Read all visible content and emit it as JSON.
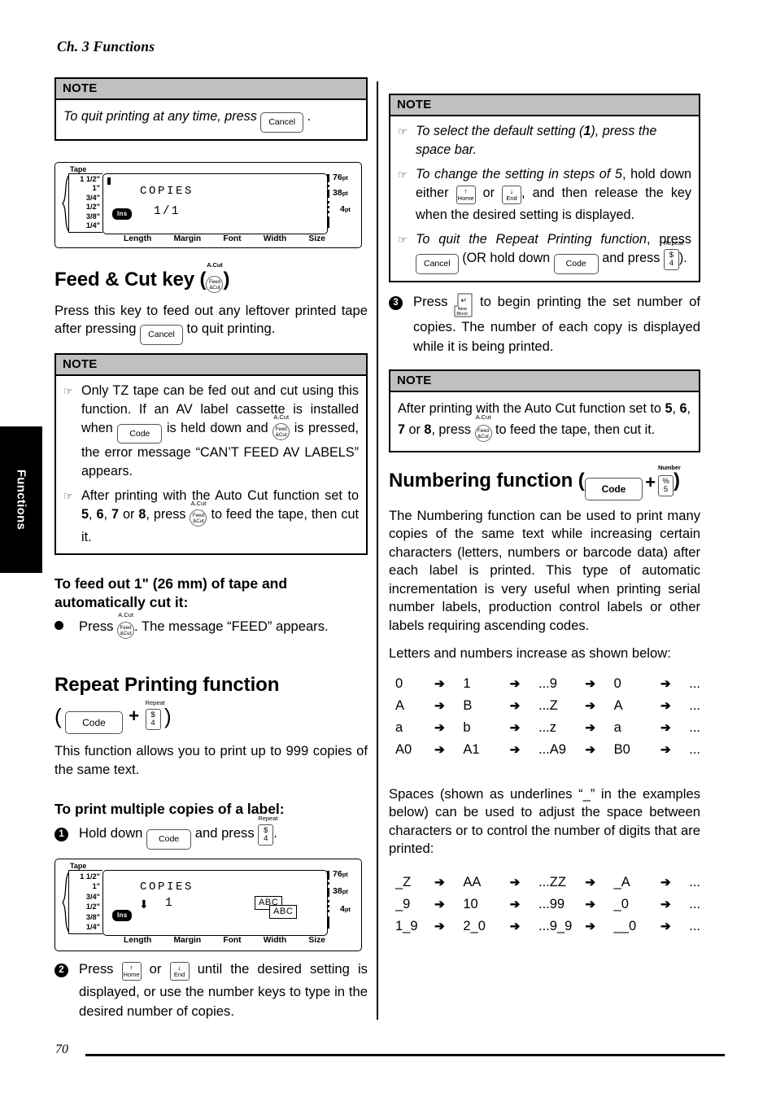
{
  "page": {
    "running_head": "Ch. 3 Functions",
    "page_number": "70",
    "thumb_tab": "Functions"
  },
  "keys": {
    "cancel": "Cancel",
    "code": "Code",
    "feedcut_top": "A.Cut",
    "feedcut_line1": "Feed",
    "feedcut_line2": "&Cut",
    "repeat_top": "Repeat",
    "repeat_sym": "$",
    "repeat_num": "4",
    "number_top": "Number",
    "number_sym": "%",
    "number_num": "5",
    "home_arrow": "↑",
    "home_label": "Home",
    "end_arrow": "↓",
    "end_label": "End",
    "newblock_arrow": "↵",
    "newblock_line1": "New",
    "newblock_line2": "Block",
    "plus": "+"
  },
  "left": {
    "note1": {
      "title": "NOTE",
      "text_before": "To quit printing at any time, press",
      "text_after": "."
    },
    "lcd1": {
      "tape_label": "Tape",
      "tape_sizes": [
        "1 1/2\"",
        "1\"",
        "3/4\"",
        "1/2\"",
        "3/8\"",
        "1/4\""
      ],
      "word": "COPIES",
      "value": "1/1",
      "ins": "Ins",
      "pt_labels": [
        "76",
        "38",
        "4"
      ],
      "pt_unit": "pt",
      "bottom_labels": [
        "Length",
        "Margin",
        "Font",
        "Width",
        "Size"
      ]
    },
    "feedcut_heading_before": "Feed & Cut key (",
    "feedcut_heading_after": ")",
    "feedcut_para_1": "Press this key to feed out any leftover printed tape after pressing",
    "feedcut_para_2": "to quit printing.",
    "note2": {
      "title": "NOTE",
      "item1_a": "Only TZ tape can be fed out and cut using this function. If an AV label cassette is installed when",
      "item1_b": "is held down and",
      "item1_c": "is pressed, the error message “CAN’T FEED AV LABELS” appears.",
      "item2_a": "After printing with the Auto Cut function set to",
      "item2_b": "5",
      "item2_c": ",",
      "item2_d": "6",
      "item2_e": ",",
      "item2_f": "7",
      "item2_g": "or",
      "item2_h": "8",
      "item2_i": ", press",
      "item2_j": "to feed the tape, then cut it."
    },
    "feedout_heading": "To feed out 1\" (26 mm) of tape and automatically cut it:",
    "feedout_bullet_a": "Press",
    "feedout_bullet_b": ". The message “FEED” appears.",
    "repeat_heading": "Repeat Printing function",
    "repeat_para": "This function allows you to print up to 999 copies of the same text.",
    "multicopy_heading": "To print multiple copies of a label:",
    "step1_a": "Hold down",
    "step1_b": "and press",
    "step1_c": ".",
    "lcd2": {
      "tape_label": "Tape",
      "tape_sizes": [
        "1 1/2\"",
        "1\"",
        "3/4\"",
        "1/2\"",
        "3/8\"",
        "1/4\""
      ],
      "word": "COPIES",
      "value": "1",
      "ins": "Ins",
      "abc1": "ABC",
      "abc2": "ABC",
      "pt_labels": [
        "76",
        "38",
        "4"
      ],
      "pt_unit": "pt",
      "bottom_labels": [
        "Length",
        "Margin",
        "Font",
        "Width",
        "Size"
      ]
    },
    "step2_a": "Press",
    "step2_b": "or",
    "step2_c": "until the desired setting is displayed, or use the number keys to type in the desired number of copies."
  },
  "right": {
    "note3": {
      "title": "NOTE",
      "item1_a": "To select the default setting (",
      "item1_b": "1",
      "item1_c": "), press the space bar.",
      "item2_a": "To change the setting in steps of 5",
      "item2_b": ", hold down either",
      "item2_c": "or",
      "item2_d": ", and then release the key when the desired setting is displayed.",
      "item3_a": "To quit the Repeat Printing function",
      "item3_b": ", press",
      "item3_c": "(OR hold down",
      "item3_d": "and press",
      "item3_e": ")."
    },
    "step3_a": "Press",
    "step3_b": "to begin printing the set number of copies. The number of each copy is displayed while it is being printed.",
    "note4": {
      "title": "NOTE",
      "text_a": "After printing with the Auto Cut function set to",
      "text_b": "5",
      "text_c": ",",
      "text_d": "6",
      "text_e": ",",
      "text_f": "7",
      "text_g": "or",
      "text_h": "8",
      "text_i": ", press",
      "text_j": "to feed the tape, then cut it."
    },
    "numbering_heading_before": "Numbering function (",
    "numbering_heading_after": ")",
    "numbering_para": "The Numbering function can be used to print many copies of the same text while increasing certain characters (letters, numbers or barcode data) after each label is printed. This type of automatic incrementation is very useful when printing serial number labels, production control labels or other labels requiring ascending codes.",
    "increase_intro": "Letters and numbers increase as shown below:",
    "increase_rows": [
      [
        "0",
        "1",
        "...9",
        "0",
        "..."
      ],
      [
        "A",
        "B",
        "...Z",
        "A",
        "..."
      ],
      [
        "a",
        "b",
        "...z",
        "a",
        "..."
      ],
      [
        "A0",
        "A1",
        "...A9",
        "B0",
        "..."
      ]
    ],
    "spaces_para": "Spaces (shown as underlines “_” in the examples below) can be used to adjust the space between characters or to control the number of digits that are printed:",
    "spaces_rows": [
      [
        "_Z",
        "AA",
        "...ZZ",
        "_A",
        "..."
      ],
      [
        "_9",
        "10",
        "...99",
        "_0",
        "..."
      ],
      [
        "1_9",
        "2_0",
        "...9_9",
        "__0",
        "..."
      ]
    ],
    "arrow": "➔"
  }
}
